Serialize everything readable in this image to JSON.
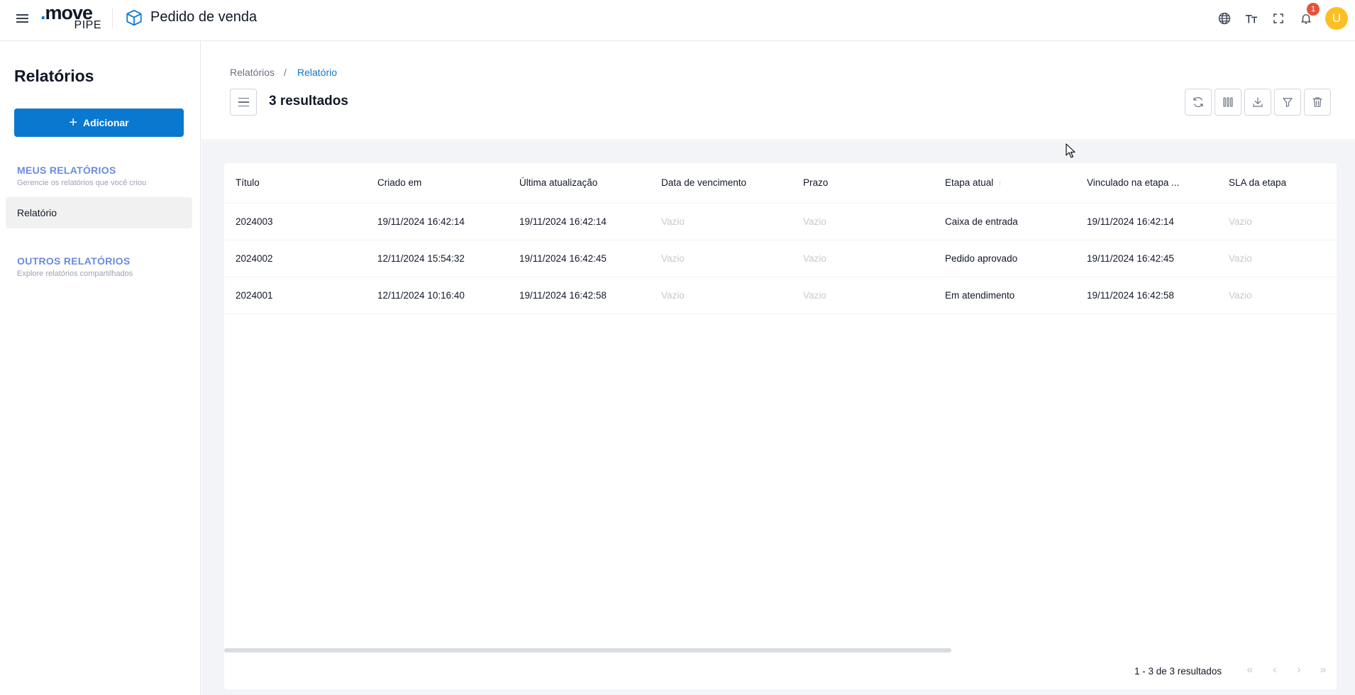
{
  "header": {
    "logo_word": "move",
    "logo_sub": "PIPE",
    "app_title": "Pedido de venda",
    "notification_count": "1",
    "avatar_initial": "U",
    "icons": [
      "menu-icon",
      "cube-icon",
      "globe-icon",
      "text-size-icon",
      "fullscreen-icon",
      "bell-icon"
    ]
  },
  "sidebar": {
    "title": "Relatórios",
    "add_label": "Adicionar",
    "my_reports": {
      "heading": "MEUS RELATÓRIOS",
      "subtitle": "Gerencie os relatórios que você criou"
    },
    "items": [
      {
        "label": "Relatório"
      }
    ],
    "other_reports": {
      "heading": "OUTROS RELATÓRIOS",
      "subtitle": "Explore relatórios compartilhados"
    }
  },
  "content": {
    "breadcrumb": {
      "parent": "Relatórios",
      "separator": "/",
      "current": "Relatório"
    },
    "results_title": "3 resultados",
    "toolbar": [
      "refresh-icon",
      "columns-icon",
      "download-icon",
      "filter-icon",
      "trash-icon"
    ]
  },
  "table": {
    "columns": [
      "Título",
      "Criado em",
      "Última atualização",
      "Data de vencimento",
      "Prazo",
      "Etapa atual",
      "Vinculado na etapa ...",
      "SLA da etapa"
    ],
    "sorted_column": "Etapa atual",
    "rows": [
      [
        "2024003",
        "19/11/2024 16:42:14",
        "19/11/2024 16:42:14",
        "Vazio",
        "Vazio",
        "Caixa de entrada",
        "19/11/2024 16:42:14",
        "Vazio"
      ],
      [
        "2024002",
        "12/11/2024 15:54:32",
        "19/11/2024 16:42:45",
        "Vazio",
        "Vazio",
        "Pedido aprovado",
        "19/11/2024 16:42:45",
        "Vazio"
      ],
      [
        "2024001",
        "12/11/2024 10:16:40",
        "19/11/2024 16:42:58",
        "Vazio",
        "Vazio",
        "Em atendimento",
        "19/11/2024 16:42:58",
        "Vazio"
      ]
    ]
  },
  "pagination": {
    "summary": "1 - 3 de 3 resultados"
  },
  "colors": {
    "primary": "#0a78cf",
    "section_heading": "#6b8be0",
    "badge": "#e5533c",
    "avatar": "#fbbf24",
    "placeholder": "#c4c9d0"
  }
}
